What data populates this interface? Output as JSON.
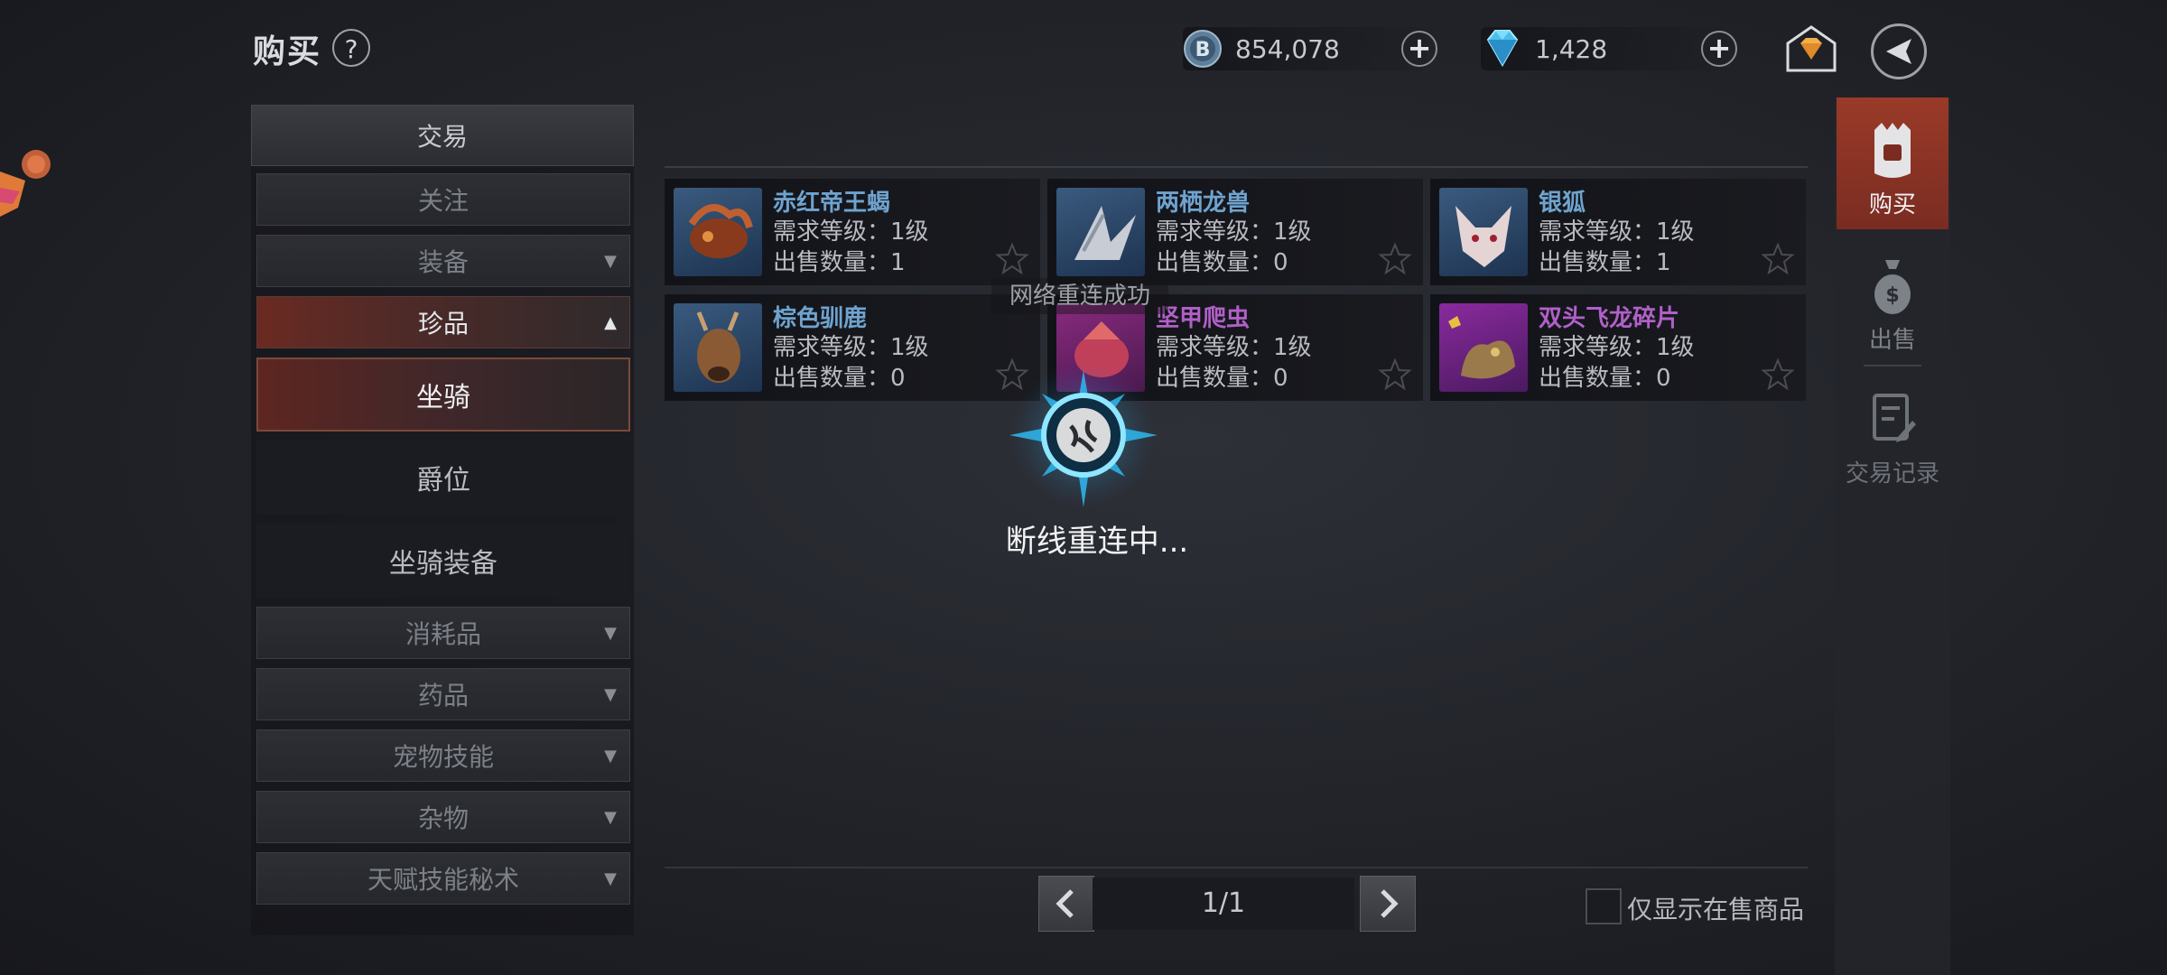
{
  "header": {
    "title": "购买",
    "help": "?",
    "coins": "854,078",
    "diamonds": "1,428",
    "coin_icon_letter": "B"
  },
  "menu": {
    "top": "交易",
    "items": [
      {
        "label": "关注"
      },
      {
        "label": "装备",
        "arrow": "▼"
      },
      {
        "label": "珍品",
        "arrow": "▲"
      },
      {
        "label": "消耗品",
        "arrow": "▼"
      },
      {
        "label": "药品",
        "arrow": "▼"
      },
      {
        "label": "宠物技能",
        "arrow": "▼"
      },
      {
        "label": "杂物",
        "arrow": "▼"
      },
      {
        "label": "天赋技能秘术",
        "arrow": "▼"
      }
    ],
    "sub": [
      "坐骑",
      "爵位",
      "坐骑装备"
    ]
  },
  "items": [
    {
      "name": "赤红帝王蝎",
      "level": "需求等级：1级",
      "qty": "出售数量：1",
      "color": "#6fa3cf"
    },
    {
      "name": "两栖龙兽",
      "level": "需求等级：1级",
      "qty": "出售数量：0",
      "color": "#6fa3cf"
    },
    {
      "name": "银狐",
      "level": "需求等级：1级",
      "qty": "出售数量：1",
      "color": "#6fa3cf"
    },
    {
      "name": "棕色驯鹿",
      "level": "需求等级：1级",
      "qty": "出售数量：0",
      "color": "#6fa3cf"
    },
    {
      "name": "坚甲爬虫",
      "level": "需求等级：1级",
      "qty": "出售数量：0",
      "color": "#b160c8"
    },
    {
      "name": "双头飞龙碎片",
      "level": "需求等级：1级",
      "qty": "出售数量：0",
      "color": "#b160c8"
    }
  ],
  "pagination": {
    "text": "1/1"
  },
  "filter_label": "仅显示在售商品",
  "right_tabs": [
    {
      "label": "购买",
      "icon": "bag-icon",
      "selected": true
    },
    {
      "label": "出售",
      "icon": "money-bag-icon",
      "selected": false
    },
    {
      "label": "交易记录",
      "icon": "record-icon",
      "selected": false
    }
  ],
  "overlay": {
    "toast": "网络重连成功",
    "status": "断线重连中..."
  }
}
